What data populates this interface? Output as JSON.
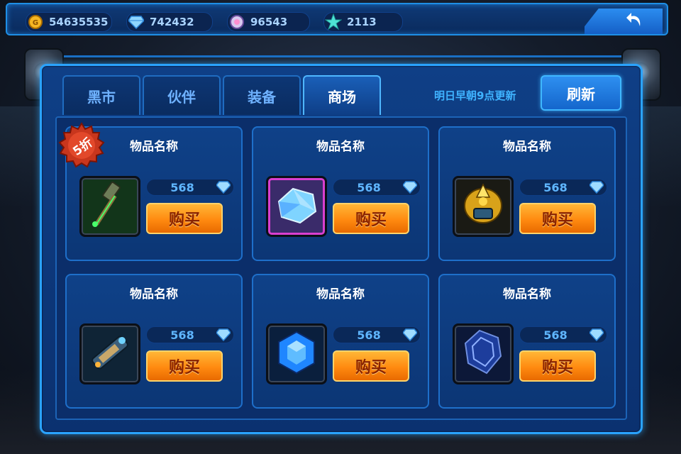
{
  "resources": [
    {
      "icon": "gold-coin-icon",
      "value": "54635535"
    },
    {
      "icon": "diamond-icon",
      "value": "742432"
    },
    {
      "icon": "crystal-orb-icon",
      "value": "96543"
    },
    {
      "icon": "star-icon",
      "value": "2113"
    }
  ],
  "tabs": [
    {
      "label": "黑市"
    },
    {
      "label": "伙伴"
    },
    {
      "label": "装备"
    },
    {
      "label": "商场"
    }
  ],
  "refresh": {
    "note": "明日早朝9点更新",
    "button": "刷新"
  },
  "discount_badge": "5折",
  "items": [
    {
      "name": "物品名称",
      "price": "568",
      "buy": "购买",
      "icon": "green-hammer-icon"
    },
    {
      "name": "物品名称",
      "price": "568",
      "buy": "购买",
      "icon": "blue-crystal-icon"
    },
    {
      "name": "物品名称",
      "price": "568",
      "buy": "购买",
      "icon": "golden-helmet-icon"
    },
    {
      "name": "物品名称",
      "price": "568",
      "buy": "购买",
      "icon": "tech-cannon-icon"
    },
    {
      "name": "物品名称",
      "price": "568",
      "buy": "购买",
      "icon": "blue-gem-icon"
    },
    {
      "name": "物品名称",
      "price": "568",
      "buy": "购买",
      "icon": "dark-shield-icon"
    }
  ],
  "colors": {
    "accent": "#2aa3ff",
    "buy_button": "#ff8a10",
    "panel": "#0f3f86"
  }
}
